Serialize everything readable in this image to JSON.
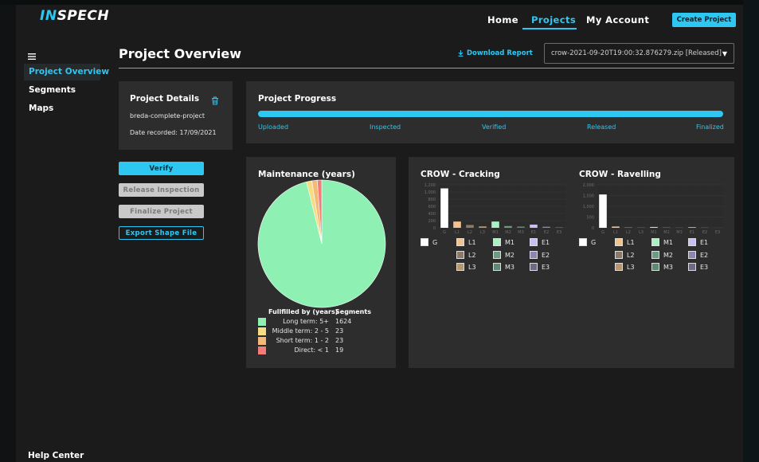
{
  "app": {
    "logo": "INSPECH"
  },
  "nav": {
    "home": "Home",
    "projects": "Projects",
    "account": "My Account",
    "create_project": "Create Project"
  },
  "sidebar": {
    "items": [
      {
        "label": "Project Overview"
      },
      {
        "label": "Segments"
      },
      {
        "label": "Maps"
      }
    ],
    "help": "Help Center"
  },
  "header": {
    "title": "Project Overview",
    "download_label": "Download Report",
    "selected_file": "crow-2021-09-20T19:00:32.876279.zip [Released]"
  },
  "project_details": {
    "title": "Project Details",
    "name": "breda-complete-project",
    "date_recorded": "Date recorded: 17/09/2021"
  },
  "actions": {
    "verify": "Verify",
    "release": "Release Inspection",
    "finalize": "Finalize Project",
    "export": "Export Shape File"
  },
  "progress": {
    "title": "Project Progress",
    "stages": [
      "Uploaded",
      "Inspected",
      "Verified",
      "Released",
      "Finalized"
    ],
    "completed_fraction": 1.0
  },
  "maintenance": {
    "title": "Maintenance (years)",
    "col_label": "Fullfilled by (years)",
    "col_segments": "Segments",
    "rows": [
      {
        "label": "Long term: 5+",
        "value": "1624",
        "color": "#8ff0b4"
      },
      {
        "label": "Middle term: 2 - 5",
        "value": "23",
        "color": "#f5dd84"
      },
      {
        "label": "Short term: 1 - 2",
        "value": "23",
        "color": "#f5b876"
      },
      {
        "label": "Direct: < 1",
        "value": "19",
        "color": "#f37c7a"
      }
    ]
  },
  "crow_cracking": {
    "title": "CROW - Cracking",
    "yticks": [
      "1,200",
      "1,000",
      "800",
      "600",
      "400",
      "200",
      "0"
    ]
  },
  "crow_ravelling": {
    "title": "CROW - Ravelling",
    "yticks": [
      "2,000",
      "1,500",
      "1,000",
      "500",
      "0"
    ]
  },
  "crow_legend": {
    "items": [
      {
        "label": "G",
        "color": "#ffffff"
      },
      {
        "label": "L1",
        "color": "#f1c48e"
      },
      {
        "label": "M1",
        "color": "#a9f1c3"
      },
      {
        "label": "E1",
        "color": "#c9bff3"
      },
      {
        "label": "L2",
        "color": "#8a7a68"
      },
      {
        "label": "M2",
        "color": "#6b9c82"
      },
      {
        "label": "E2",
        "color": "#8e86b0"
      },
      {
        "label": "L3",
        "color": "#b89670"
      },
      {
        "label": "M3",
        "color": "#5e8a73"
      },
      {
        "label": "E3",
        "color": "#6f6986"
      }
    ]
  },
  "chart_data": [
    {
      "type": "pie",
      "title": "Maintenance (years)",
      "categories": [
        "Long term: 5+",
        "Middle term: 2 - 5",
        "Short term: 1 - 2",
        "Direct: < 1"
      ],
      "values": [
        1624,
        23,
        23,
        19
      ]
    },
    {
      "type": "bar",
      "title": "CROW - Cracking",
      "categories": [
        "G",
        "L1",
        "L2",
        "L3",
        "M1",
        "M2",
        "M3",
        "E1",
        "E2",
        "E3"
      ],
      "values": [
        1100,
        175,
        80,
        40,
        175,
        50,
        35,
        90,
        30,
        15
      ],
      "ylim": [
        0,
        1200
      ]
    },
    {
      "type": "bar",
      "title": "CROW - Ravelling",
      "categories": [
        "G",
        "L1",
        "L2",
        "L3",
        "M1",
        "M2",
        "M3",
        "E1",
        "E2",
        "E3"
      ],
      "values": [
        1550,
        60,
        25,
        10,
        40,
        15,
        8,
        30,
        10,
        5
      ],
      "ylim": [
        0,
        2000
      ]
    }
  ]
}
